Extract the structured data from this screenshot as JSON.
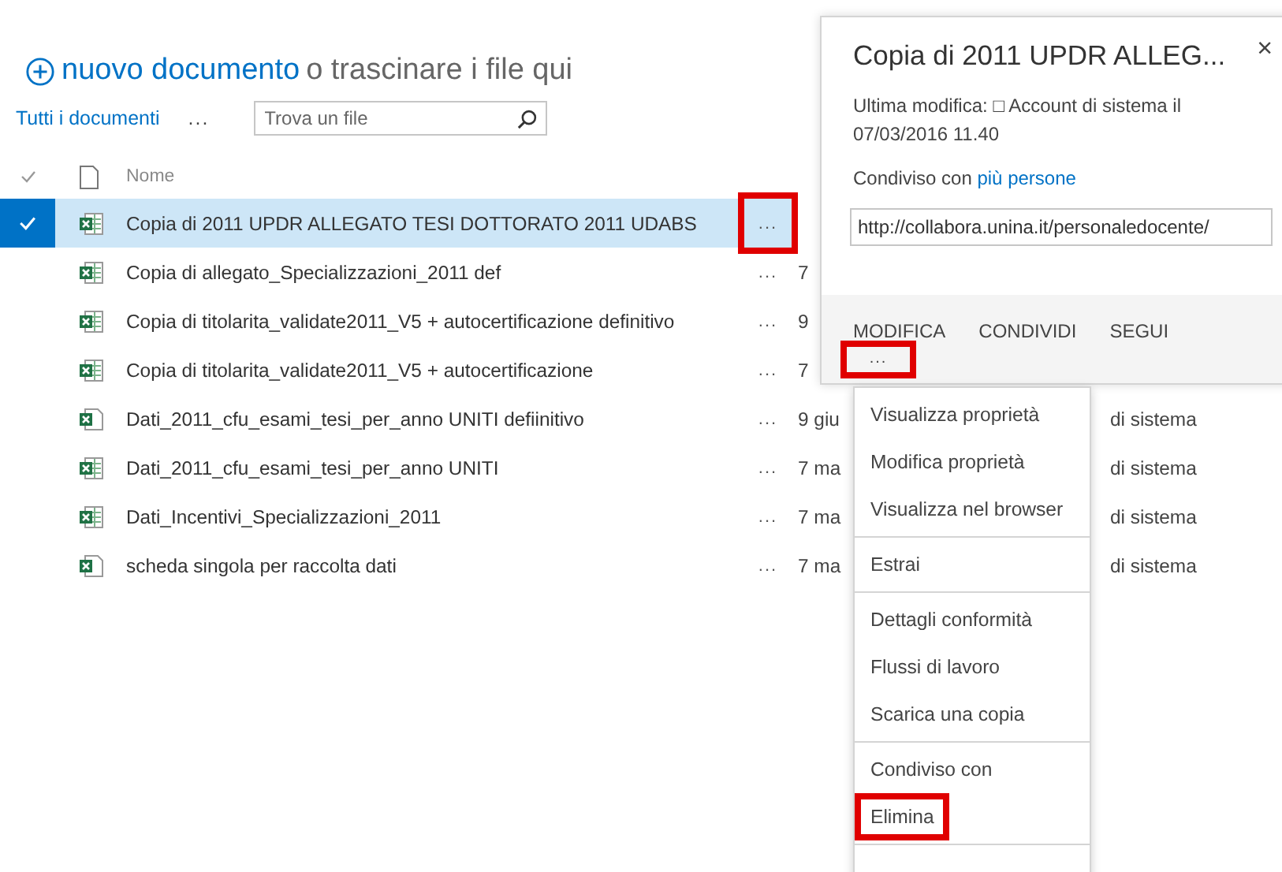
{
  "header": {
    "new_document": "nuovo documento",
    "drag_hint": "o trascinare i file qui"
  },
  "toolbar": {
    "view": "Tutti i documenti",
    "more": "...",
    "search": {
      "placeholder": "Trova un file"
    }
  },
  "columns": {
    "name": "Nome"
  },
  "rows": [
    {
      "name": "Copia di 2011 UPDR ALLEGATO TESI DOTTORATO 2011 UDABS",
      "kind": "grid",
      "selected": true,
      "highlighted": true,
      "more": "..."
    },
    {
      "name": "Copia di allegato_Specializzazioni_2011 def",
      "kind": "grid",
      "selected": false,
      "highlighted": false,
      "more": "...",
      "modified": "7"
    },
    {
      "name": "Copia di titolarita_validate2011_V5 + autocertificazione definitivo",
      "kind": "grid",
      "selected": false,
      "highlighted": false,
      "more": "...",
      "modified": "9"
    },
    {
      "name": "Copia di titolarita_validate2011_V5 + autocertificazione",
      "kind": "grid",
      "selected": false,
      "highlighted": false,
      "more": "...",
      "modified": "7"
    },
    {
      "name": "Dati_2011_cfu_esami_tesi_per_anno UNITI defiinitivo",
      "kind": "plain",
      "selected": false,
      "highlighted": false,
      "more": "...",
      "modified": "9 giu",
      "modified_by": "di sistema"
    },
    {
      "name": "Dati_2011_cfu_esami_tesi_per_anno UNITI",
      "kind": "grid",
      "selected": false,
      "highlighted": false,
      "more": "...",
      "modified": "7 ma",
      "modified_by": "di sistema"
    },
    {
      "name": "Dati_Incentivi_Specializzazioni_2011",
      "kind": "grid",
      "selected": false,
      "highlighted": false,
      "more": "...",
      "modified": "7 ma",
      "modified_by": "di sistema"
    },
    {
      "name": "scheda singola per raccolta dati",
      "kind": "plain",
      "selected": false,
      "highlighted": false,
      "more": "...",
      "modified": "7 ma",
      "modified_by": "di sistema"
    }
  ],
  "callout": {
    "title": "Copia di 2011 UPDR ALLEG...",
    "close": "×",
    "modified_info": "Ultima modifica: □ Account di sistema il 07/03/2016 11.40",
    "shared_prefix": "Condiviso con",
    "shared_link": "più persone",
    "url": "http://collabora.unina.it/personaledocente/",
    "actions": [
      "MODIFICA",
      "CONDIVIDI",
      "SEGUI"
    ],
    "more": {
      "label": "...",
      "highlighted": true
    }
  },
  "menu": [
    [
      {
        "label": "Visualizza proprietà",
        "highlighted": false
      },
      {
        "label": "Modifica proprietà",
        "highlighted": false
      },
      {
        "label": "Visualizza nel browser",
        "highlighted": false
      }
    ],
    [
      {
        "label": "Estrai",
        "highlighted": false
      }
    ],
    [
      {
        "label": "Dettagli conformità",
        "highlighted": false
      },
      {
        "label": "Flussi di lavoro",
        "highlighted": false
      },
      {
        "label": "Scarica una copia",
        "highlighted": false
      }
    ],
    [
      {
        "label": "Condiviso con",
        "highlighted": false
      },
      {
        "label": "Elimina",
        "highlighted": true
      }
    ]
  ]
}
